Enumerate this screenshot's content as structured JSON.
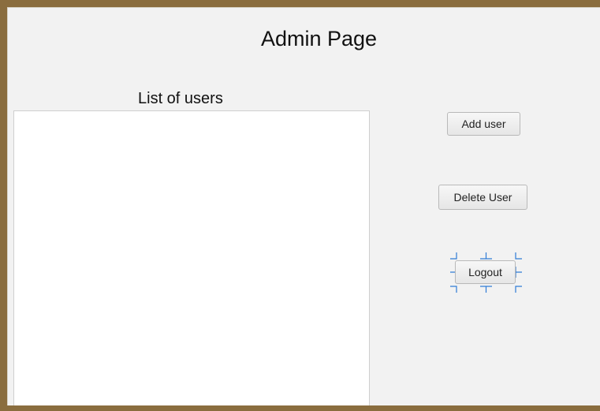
{
  "header": {
    "title": "Admin Page"
  },
  "users_list": {
    "label": "List of users",
    "items": []
  },
  "actions": {
    "add_user_label": "Add user",
    "delete_user_label": "Delete User",
    "logout_label": "Logout"
  },
  "colors": {
    "window_frame": "#8a6d3e",
    "panel_background": "#f2f2f2",
    "list_background": "#ffffff",
    "selection_handles": "#2f7bd6"
  }
}
